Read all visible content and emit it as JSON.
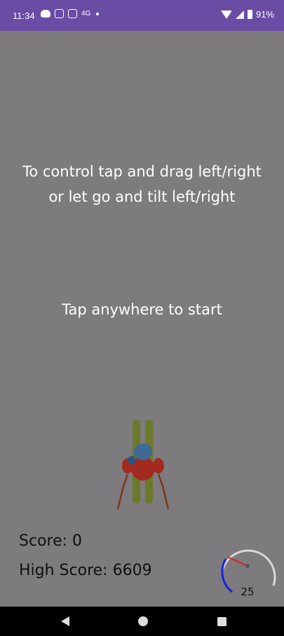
{
  "status_bar": {
    "time": "11:34",
    "network_label": "4G",
    "battery": "91%",
    "icons": [
      "chat-icon",
      "instagram-icon",
      "instagram-icon",
      "network-icon",
      "dot-icon",
      "wifi-icon",
      "signal-icon",
      "battery-icon"
    ]
  },
  "game": {
    "instructions_line1": "To control tap and drag left/right",
    "instructions_line2": "or let go and tilt left/right",
    "start_prompt": "Tap anywhere to start",
    "score_label": "Score: 0",
    "high_score_label": "High Score: 6609",
    "speed_value": "25",
    "colors": {
      "background": "#7d7b7e",
      "ski": "#6b7a2a",
      "jacket": "#a32a1f",
      "helmet": "#3e6a95",
      "gauge_arc": "#d8d8d8",
      "gauge_active": "#1a22e6",
      "needle": "#e21f1f"
    }
  },
  "nav_bar": {
    "icons": [
      "back-icon",
      "home-icon",
      "recents-icon"
    ]
  }
}
